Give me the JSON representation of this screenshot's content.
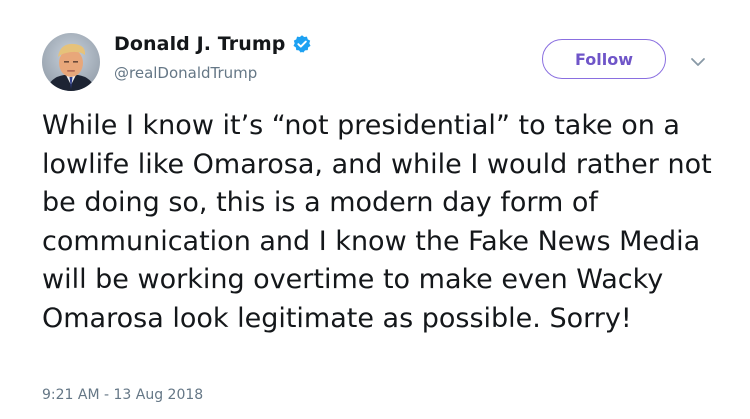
{
  "author": {
    "display_name": "Donald J. Trump",
    "handle": "@realDonaldTrump",
    "verified": true,
    "avatar_icon": "profile-photo"
  },
  "actions": {
    "follow_label": "Follow",
    "more_icon": "chevron-down-icon"
  },
  "tweet": {
    "text": "While I know it’s “not presidential” to take on a lowlife like Omarosa, and while I would rather not be doing so, this is a modern day form of communication and I know the Fake News Media will be working overtime to make even Wacky Omarosa look legitimate as possible. Sorry!",
    "timestamp": "9:21 AM - 13 Aug 2018"
  },
  "colors": {
    "text": "#14171a",
    "secondary_text": "#657786",
    "verified_badge": "#1da1f2",
    "follow_accent": "#6f55c8"
  }
}
